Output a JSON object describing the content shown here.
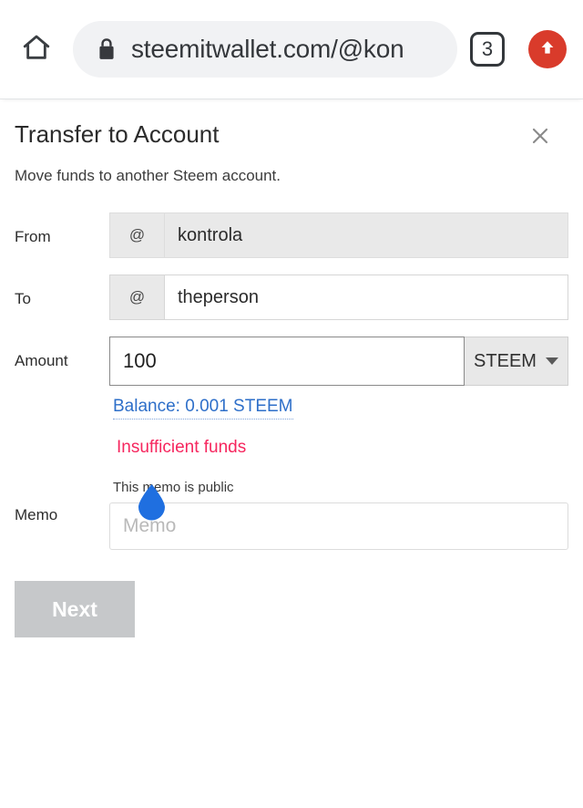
{
  "browser": {
    "home_icon": "home-icon",
    "lock_icon": "lock-icon",
    "url": "steemitwallet.com/@kon",
    "tab_count": "3",
    "action_icon": "upload-arrow-icon",
    "action_color": "#d93b2b"
  },
  "dialog": {
    "title": "Transfer to Account",
    "subtitle": "Move funds to another Steem account.",
    "close_icon": "close-icon"
  },
  "form": {
    "from": {
      "label": "From",
      "prefix": "@",
      "value": "kontrola",
      "placeholder": ""
    },
    "to": {
      "label": "To",
      "prefix": "@",
      "value": "theperson",
      "placeholder": ""
    },
    "amount": {
      "label": "Amount",
      "value": "100",
      "placeholder": "",
      "unit": "STEEM",
      "unit_chevron": "chevron-down-icon",
      "balance_link": "Balance: 0.001 STEEM",
      "error": "Insufficient funds",
      "error_color": "#f6265e",
      "link_color": "#2e6fc9"
    },
    "memo": {
      "label": "Memo",
      "hint": "This memo is public",
      "value": "",
      "placeholder": "Memo"
    }
  },
  "actions": {
    "next_label": "Next",
    "next_disabled_color": "#c6c8ca"
  },
  "overlay": {
    "cursor_handle": "text-cursor-handle",
    "cursor_handle_color": "#1f6fe0"
  }
}
